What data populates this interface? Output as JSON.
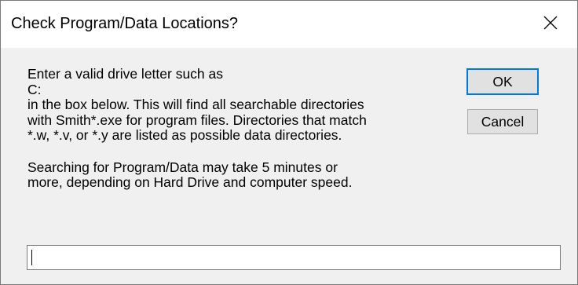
{
  "window": {
    "title": "Check Program/Data Locations?"
  },
  "icons": {
    "close": "close-icon"
  },
  "message": {
    "lines": [
      "Enter a valid drive letter such as",
      "C:",
      "in the box below.  This will find all searchable directories",
      "with Smith*.exe for program files.  Directories that match",
      "*.w, *.v, or *.y are listed as possible data directories.",
      "",
      "Searching for Program/Data may take 5 minutes or",
      "more, depending on Hard Drive and computer speed."
    ]
  },
  "buttons": {
    "ok_label": "OK",
    "cancel_label": "Cancel"
  },
  "input": {
    "value": "",
    "placeholder": ""
  },
  "colors": {
    "dialog_background": "#f0f0f0",
    "titlebar_background": "#ffffff",
    "focus_border": "#0078d7"
  }
}
